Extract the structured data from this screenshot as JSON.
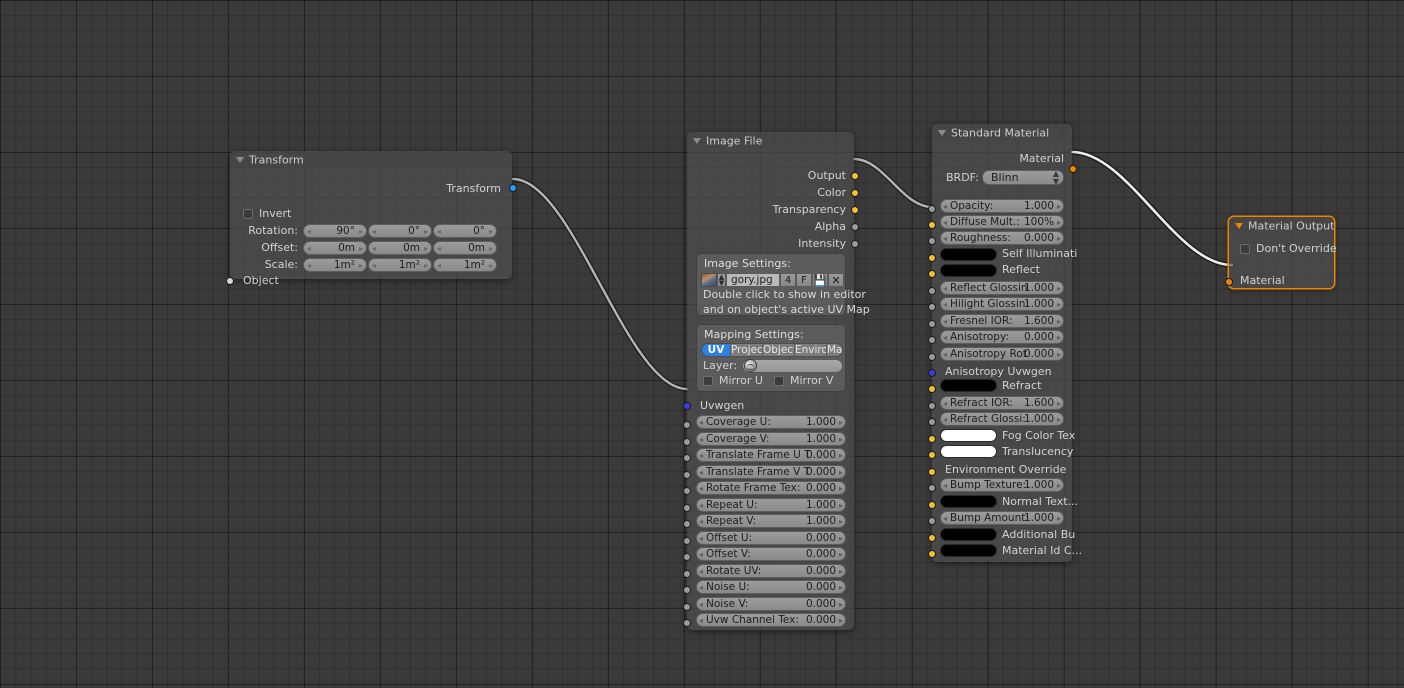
{
  "editor": {
    "name": "node-editor-canvas",
    "background_color": "#3a3a3a",
    "grid_color": "#313131"
  },
  "nodes": [
    {
      "id": "transform",
      "title": "Transform",
      "selected": false,
      "outputs": [
        {
          "label": "Transform",
          "socket_color": "#1e9eff"
        }
      ],
      "checkbox": {
        "label": "Invert",
        "checked": false
      },
      "fields": [
        {
          "label": "Rotation:",
          "values": [
            "90°",
            "0°",
            "0°"
          ]
        },
        {
          "label": "Offset:",
          "values": [
            "0m",
            "0m",
            "0m"
          ]
        },
        {
          "label": "Scale:",
          "values": [
            "1m²",
            "1m²",
            "1m²"
          ]
        }
      ],
      "inputs": [
        {
          "label": "Object",
          "socket_color": "#d8d8d8"
        }
      ]
    },
    {
      "id": "image_file",
      "title": "Image File",
      "selected": false,
      "outputs": [
        {
          "label": "Output",
          "socket_color": "#f2c12e"
        },
        {
          "label": "Color",
          "socket_color": "#f2c12e"
        },
        {
          "label": "Transparency",
          "socket_color": "#f2c12e"
        },
        {
          "label": "Alpha",
          "socket_color": "#9a9a9a"
        },
        {
          "label": "Intensity",
          "socket_color": "#9a9a9a"
        }
      ],
      "image_settings": {
        "title": "Image Settings:",
        "filename": "gory.jpg",
        "frames": "4",
        "mode": "F",
        "thumb_icon": "image-thumbnail-icon",
        "spinner_icon": "spinner-updown-icon",
        "save_icon": "save-disk-icon",
        "clear_icon": "clear-x-icon",
        "help_line1": "Double click to show in editor",
        "help_line2": "and on object's active UV Map"
      },
      "mapping_settings": {
        "title": "Mapping Settings:",
        "tabs": [
          "UV",
          "Projec",
          "Object",
          "Enviro",
          "Manu"
        ],
        "active_tab": "UV",
        "active_tab_color": "#2f7fe0",
        "layer_label": "Layer:",
        "layer_value": "",
        "layer_icon": "globe-icon",
        "mirror_u": {
          "label": "Mirror U",
          "checked": false
        },
        "mirror_v": {
          "label": "Mirror V",
          "checked": false
        }
      },
      "uvwgen_label": "Uvwgen",
      "uvwgen_socket_color": "#3c3cdd",
      "params": [
        {
          "label": "Coverage U:",
          "value": "1.000",
          "socket_color": "#9a9a9a"
        },
        {
          "label": "Coverage V:",
          "value": "1.000",
          "socket_color": "#9a9a9a"
        },
        {
          "label": "Translate Frame U T",
          "value": "0.000",
          "socket_color": "#9a9a9a"
        },
        {
          "label": "Translate Frame V T",
          "value": "0.000",
          "socket_color": "#9a9a9a"
        },
        {
          "label": "Rotate Frame Tex:",
          "value": "0.000",
          "socket_color": "#9a9a9a"
        },
        {
          "label": "Repeat U:",
          "value": "1.000",
          "socket_color": "#9a9a9a"
        },
        {
          "label": "Repeat V:",
          "value": "1.000",
          "socket_color": "#9a9a9a"
        },
        {
          "label": "Offset U:",
          "value": "0.000",
          "socket_color": "#9a9a9a"
        },
        {
          "label": "Offset V:",
          "value": "0.000",
          "socket_color": "#9a9a9a"
        },
        {
          "label": "Rotate UV:",
          "value": "0.000",
          "socket_color": "#9a9a9a"
        },
        {
          "label": "Noise U:",
          "value": "0.000",
          "socket_color": "#9a9a9a"
        },
        {
          "label": "Noise V:",
          "value": "0.000",
          "socket_color": "#9a9a9a"
        },
        {
          "label": "Uvw Channel Tex:",
          "value": "0.000",
          "socket_color": "#9a9a9a"
        }
      ]
    },
    {
      "id": "standard_material",
      "title": "Standard Material",
      "selected": false,
      "outputs": [
        {
          "label": "Material",
          "socket_color": "#ef8400"
        }
      ],
      "brdf": {
        "label": "BRDF:",
        "value": "Blinn"
      },
      "rows": [
        {
          "kind": "pill",
          "label": "Opacity:",
          "value": "1.000",
          "socket_color": "#9a9a9a"
        },
        {
          "kind": "pill",
          "label": "Diffuse Mult.:",
          "value": "100%",
          "socket_color": "#f2c12e"
        },
        {
          "kind": "pill",
          "label": "Roughness:",
          "value": "0.000",
          "socket_color": "#9a9a9a"
        },
        {
          "kind": "swatch",
          "label": "Self Illuminati",
          "color": "#000000",
          "socket_color": "#f2c12e"
        },
        {
          "kind": "swatch",
          "label": "Reflect",
          "color": "#000000",
          "socket_color": "#f2c12e"
        },
        {
          "kind": "pill",
          "label": "Reflect Glossin",
          "value": "1.000",
          "socket_color": "#9a9a9a"
        },
        {
          "kind": "pill",
          "label": "Hilight Glossin:",
          "value": "1.000",
          "socket_color": "#9a9a9a"
        },
        {
          "kind": "pill",
          "label": "Fresnel IOR:",
          "value": "1.600",
          "socket_color": "#9a9a9a"
        },
        {
          "kind": "pill",
          "label": "Anisotropy:",
          "value": "0.000",
          "socket_color": "#9a9a9a"
        },
        {
          "kind": "pill",
          "label": "Anisotropy Rot",
          "value": "0.000",
          "socket_color": "#9a9a9a"
        },
        {
          "kind": "text",
          "label": "Anisotropy Uvwgen",
          "socket_color": "#3c3cdd"
        },
        {
          "kind": "swatch",
          "label": "Refract",
          "color": "#000000",
          "socket_color": "#f2c12e"
        },
        {
          "kind": "pill",
          "label": "Refract IOR:",
          "value": "1.600",
          "socket_color": "#9a9a9a"
        },
        {
          "kind": "pill",
          "label": "Refract Glossi:",
          "value": "1.000",
          "socket_color": "#9a9a9a"
        },
        {
          "kind": "swatch",
          "label": "Fog Color Tex",
          "color": "#ffffff",
          "socket_color": "#f2c12e"
        },
        {
          "kind": "swatch",
          "label": "Translucency",
          "color": "#ffffff",
          "socket_color": "#f2c12e"
        },
        {
          "kind": "text",
          "label": "Environment Override",
          "socket_color": "#f2c12e"
        },
        {
          "kind": "pill",
          "label": "Bump Texture:",
          "value": "1.000",
          "socket_color": "#9a9a9a"
        },
        {
          "kind": "swatch",
          "label": "Normal Text...",
          "color": "#000000",
          "socket_color": "#f2c12e"
        },
        {
          "kind": "pill",
          "label": "Bump Amount:",
          "value": "1.000",
          "socket_color": "#9a9a9a"
        },
        {
          "kind": "swatch",
          "label": "Additional Bu",
          "color": "#000000",
          "socket_color": "#f2c12e"
        },
        {
          "kind": "swatch",
          "label": "Material Id C...",
          "color": "#000000",
          "socket_color": "#f2c12e"
        }
      ]
    },
    {
      "id": "material_output",
      "title": "Material Output",
      "selected": true,
      "border_color": "#ef8400",
      "checkbox": {
        "label": "Don't Override",
        "checked": false
      },
      "inputs": [
        {
          "label": "Material",
          "socket_color": "#ef8400"
        }
      ]
    }
  ],
  "connections": [
    {
      "from": "transform.Transform",
      "to": "image_file.Uvwgen",
      "color": "#b4b4b4"
    },
    {
      "from": "image_file.Output",
      "to": "standard_material.DiffuseMult",
      "color": "#b4b4b4"
    },
    {
      "from": "standard_material.Material",
      "to": "material_output.Material",
      "color": "#ededed"
    }
  ]
}
